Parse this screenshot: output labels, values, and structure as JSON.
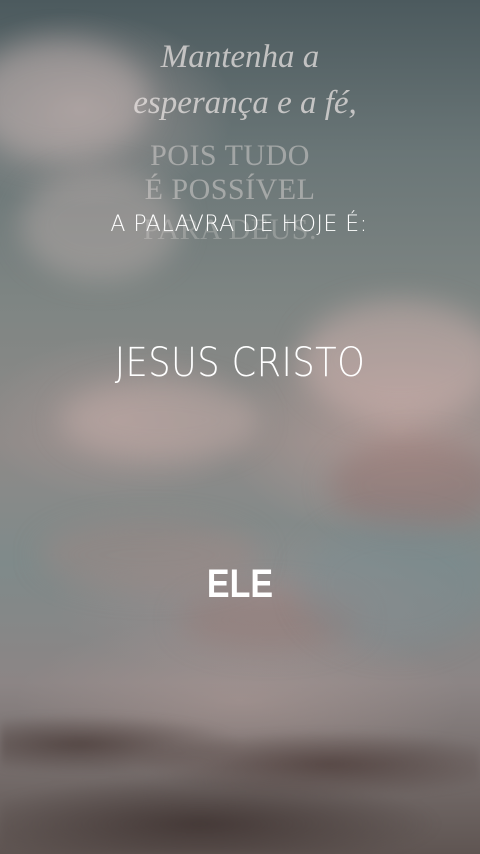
{
  "background_quote": {
    "line1": "Mantenha a",
    "line2": "esperança e a fé,",
    "line3": "POIS TUDO",
    "line4": "É POSSÍVEL",
    "line5": "PARA DEUS."
  },
  "overlay": {
    "label": "A PALAVRA DE HOJE É:",
    "main": "JESUS CRISTO",
    "word": "ELE"
  }
}
